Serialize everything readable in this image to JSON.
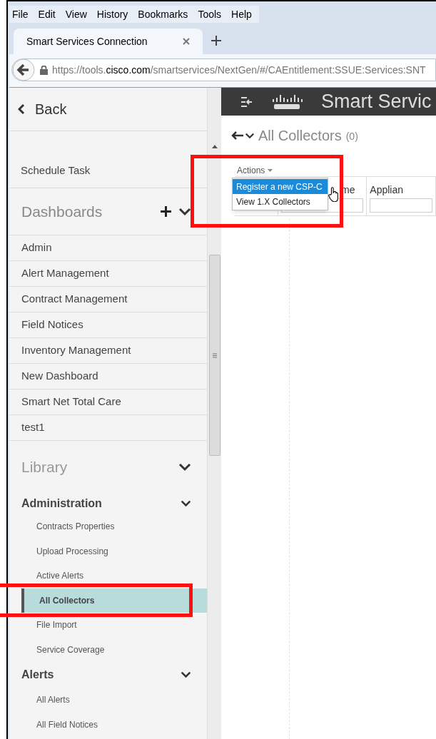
{
  "menu_bar": [
    "File",
    "Edit",
    "View",
    "History",
    "Bookmarks",
    "Tools",
    "Help"
  ],
  "tabs": [
    {
      "label": "Smart Services Connection",
      "selected": true
    }
  ],
  "address_bar": {
    "prefix": "https://tools.",
    "domain": "cisco.com",
    "path": "/smartservices/NextGen/#/CAEntitlement:SSUE:Services:SNT"
  },
  "app_header": {
    "title": "Smart Servic"
  },
  "sidebar": {
    "back": "Back",
    "top_items": [
      "Schedule Task"
    ],
    "dashboards": {
      "title": "Dashboards",
      "expanded": true,
      "items": [
        "Admin",
        "Alert Management",
        "Contract Management",
        "Field Notices",
        "Inventory Management",
        "New Dashboard",
        "Smart Net Total Care",
        "test1"
      ]
    },
    "library": {
      "title": "Library",
      "expanded": true,
      "groups": [
        {
          "title": "Administration",
          "expanded": true,
          "items": [
            {
              "label": "Contracts Properties",
              "selected": false
            },
            {
              "label": "Upload Processing",
              "selected": false
            },
            {
              "label": "Active Alerts",
              "selected": false
            },
            {
              "label": "All Collectors",
              "selected": true
            },
            {
              "label": "File Import",
              "selected": false
            },
            {
              "label": "Service Coverage",
              "selected": false
            }
          ]
        },
        {
          "title": "Alerts",
          "expanded": true,
          "items": [
            {
              "label": "All Alerts",
              "selected": false
            },
            {
              "label": "All Field Notices",
              "selected": false
            }
          ]
        }
      ]
    }
  },
  "page": {
    "title": "All Collectors",
    "count": "(0)",
    "actions_label": "Actions",
    "actions_menu": [
      {
        "label": "Register a new CSP-C",
        "selected": true
      },
      {
        "label": "View 1.X Collectors",
        "selected": false
      }
    ],
    "table": {
      "columns": [
        "me",
        "Applian"
      ]
    }
  }
}
